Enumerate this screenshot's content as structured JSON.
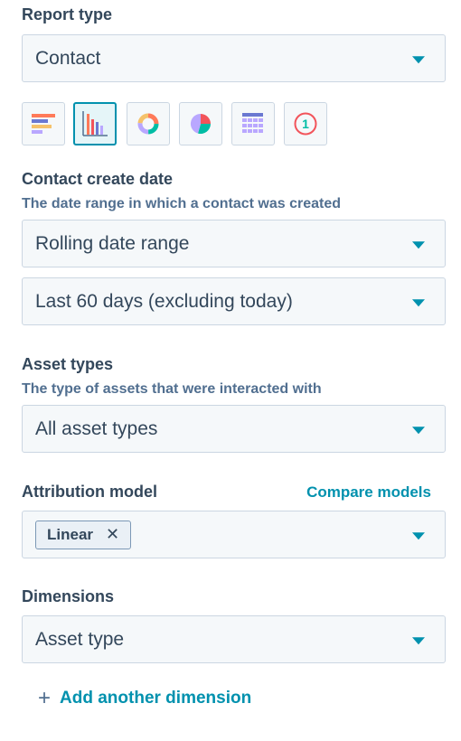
{
  "report_type": {
    "label": "Report type",
    "value": "Contact"
  },
  "visualizations": [
    {
      "icon": "horizontal-bar-chart-icon",
      "active": false
    },
    {
      "icon": "vertical-bar-chart-icon",
      "active": true
    },
    {
      "icon": "donut-chart-icon",
      "active": false
    },
    {
      "icon": "pie-chart-icon",
      "active": false
    },
    {
      "icon": "table-grid-icon",
      "active": false
    },
    {
      "icon": "single-value-icon",
      "active": false,
      "text": "1"
    }
  ],
  "contact_create_date": {
    "label": "Contact create date",
    "help": "The date range in which a contact was created",
    "range_type": "Rolling date range",
    "range_value": "Last 60 days (excluding today)"
  },
  "asset_types": {
    "label": "Asset types",
    "help": "The type of assets that were interacted with",
    "value": "All asset types"
  },
  "attribution_model": {
    "label": "Attribution model",
    "compare_link": "Compare models",
    "tag": "Linear"
  },
  "dimensions": {
    "label": "Dimensions",
    "value": "Asset type",
    "add_label": "Add another dimension"
  },
  "colors": {
    "accent": "#0091ae",
    "orange": "#ff7a59",
    "coral": "#f2545b",
    "purple": "#6a78d1",
    "light_purple": "#b9a7ff",
    "teal": "#00bda5",
    "yellow": "#f5c26b"
  }
}
